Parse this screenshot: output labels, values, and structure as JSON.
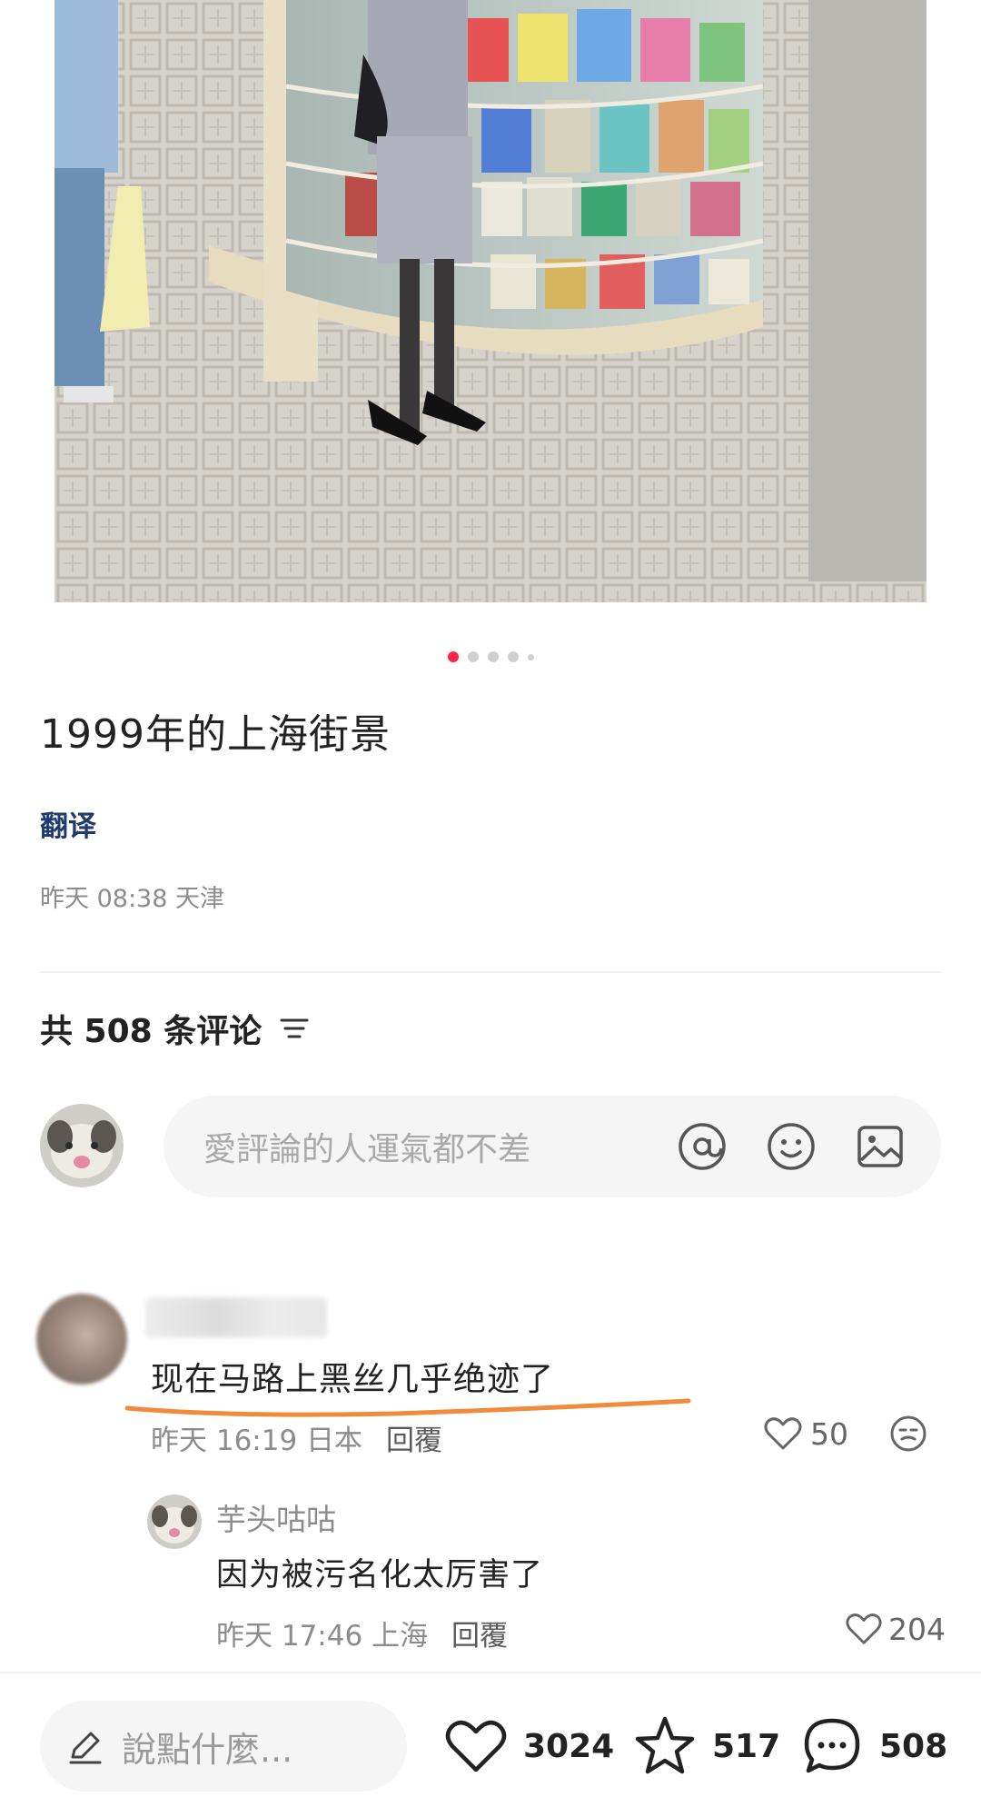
{
  "carousel": {
    "total": 5,
    "active_index": 0
  },
  "post": {
    "title": "1999年的上海街景",
    "translate_label": "翻译",
    "meta": "昨天 08:38 天津"
  },
  "comments_header": {
    "count_label": "共 508 条评论"
  },
  "comment_input": {
    "placeholder": "愛評論的人運氣都不差"
  },
  "comments": [
    {
      "text": "现在马路上黑丝几乎绝迹了",
      "meta": "昨天 16:19 日本",
      "reply_label": "回覆",
      "likes": "50",
      "replies": [
        {
          "author": "芋头咕咕",
          "text": "因为被污名化太厉害了",
          "meta": "昨天 17:46 上海",
          "reply_label": "回覆",
          "likes": "204"
        }
      ]
    }
  ],
  "bottom_bar": {
    "say_placeholder": "說點什麼...",
    "like_count": "3024",
    "collect_count": "517",
    "comment_count": "508"
  },
  "colors": {
    "accent": "#ff2442",
    "link": "#1f3a6d",
    "underline": "#f08a3c"
  }
}
